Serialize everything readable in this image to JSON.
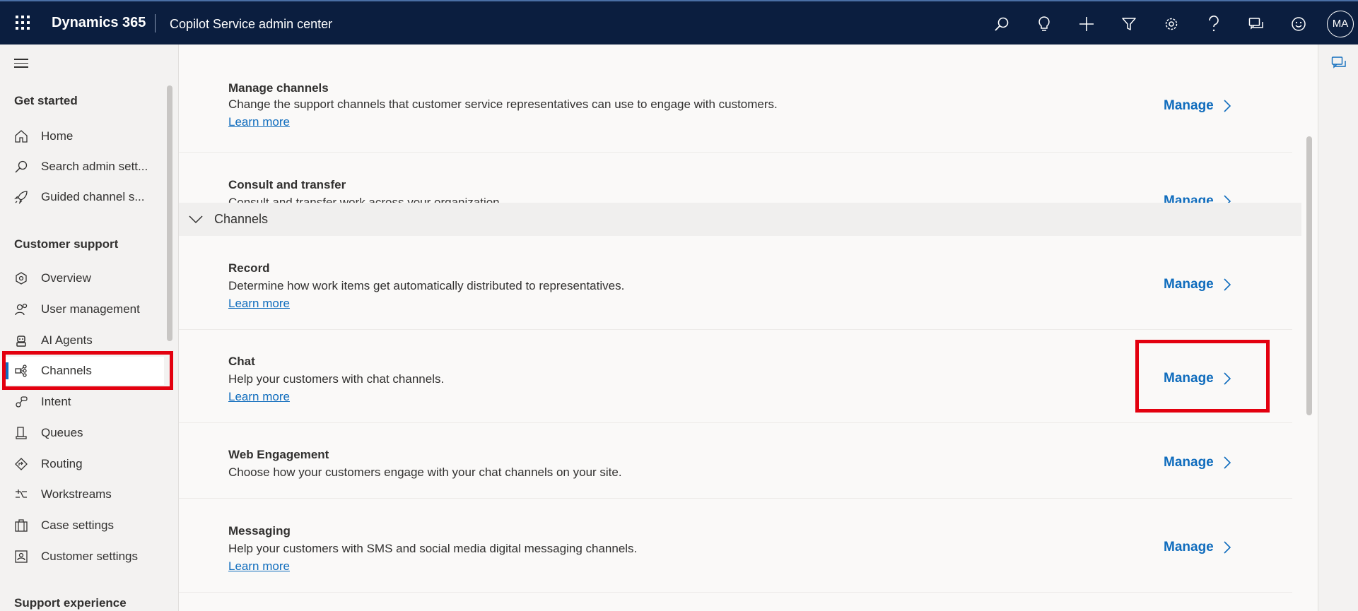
{
  "topbar": {
    "brand": "Dynamics 365",
    "app_title": "Copilot Service admin center",
    "avatar_initials": "MA",
    "icons": [
      "search-icon",
      "lightbulb-icon",
      "plus-icon",
      "filter-icon",
      "settings-icon",
      "help-icon",
      "chat-feedback-icon",
      "smiley-icon"
    ]
  },
  "sidebar": {
    "sections": [
      {
        "title": "Get started",
        "items": [
          {
            "label": "Home",
            "icon": "home-icon"
          },
          {
            "label": "Search admin sett...",
            "icon": "search-icon"
          },
          {
            "label": "Guided channel s...",
            "icon": "rocket-icon"
          }
        ]
      },
      {
        "title": "Customer support",
        "items": [
          {
            "label": "Overview",
            "icon": "overview-icon"
          },
          {
            "label": "User management",
            "icon": "users-icon"
          },
          {
            "label": "AI Agents",
            "icon": "bot-icon"
          },
          {
            "label": "Channels",
            "icon": "channels-icon",
            "active": true
          },
          {
            "label": "Intent",
            "icon": "intent-icon"
          },
          {
            "label": "Queues",
            "icon": "queues-icon"
          },
          {
            "label": "Routing",
            "icon": "routing-icon"
          },
          {
            "label": "Workstreams",
            "icon": "workstreams-icon"
          },
          {
            "label": "Case settings",
            "icon": "briefcase-icon"
          },
          {
            "label": "Customer settings",
            "icon": "contact-card-icon"
          }
        ]
      },
      {
        "title": "Support experience",
        "items": []
      }
    ]
  },
  "main": {
    "manage_label": "Manage",
    "learn_more": "Learn more",
    "rows_top": [
      {
        "title": "Manage channels",
        "desc": "Change the support channels that customer service representatives can use to engage with customers.",
        "has_link": true
      },
      {
        "title": "Consult and transfer",
        "desc": "Consult and transfer work across your organization.",
        "has_link": true
      }
    ],
    "group": {
      "label": "Channels"
    },
    "rows_channels": [
      {
        "title": "Record",
        "desc": "Determine how work items get automatically distributed to representatives.",
        "has_link": true
      },
      {
        "title": "Chat",
        "desc": "Help your customers with chat channels.",
        "has_link": true
      },
      {
        "title": "Web Engagement",
        "desc": "Choose how your customers engage with your chat channels on your site.",
        "has_link": false
      },
      {
        "title": "Messaging",
        "desc": "Help your customers with SMS and social media digital messaging channels.",
        "has_link": true
      }
    ]
  },
  "colors": {
    "topbar_bg": "#0b1e3f",
    "accent": "#0f6cbd",
    "highlight": "#e3000f"
  }
}
